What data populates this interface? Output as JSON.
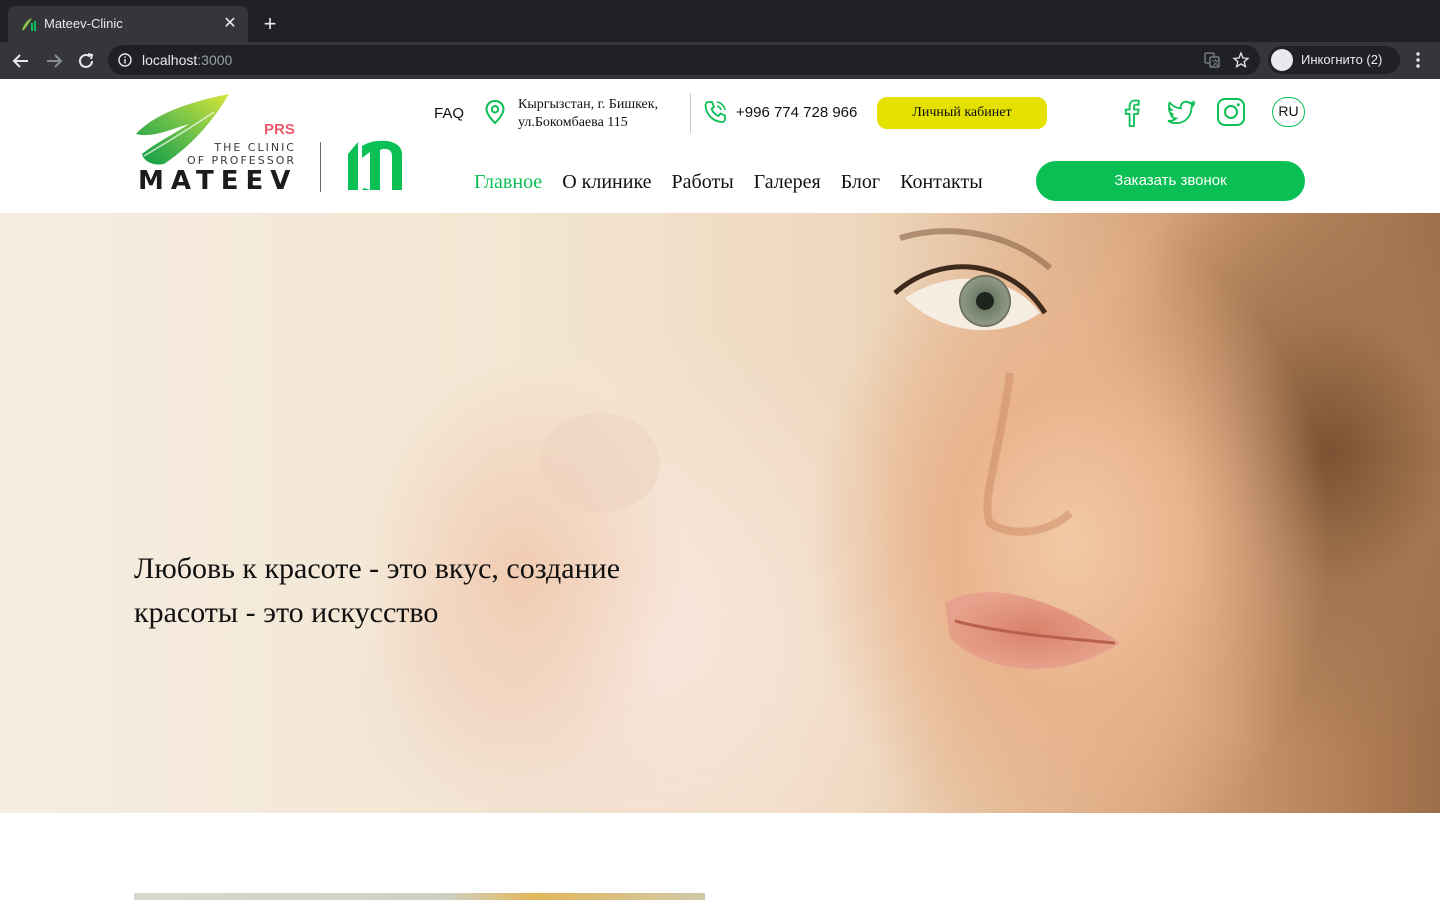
{
  "browser": {
    "tab_title": "Mateev-Clinic",
    "url_host": "localhost",
    "url_port": ":3000",
    "incognito_label": "Инкогнито (2)"
  },
  "header": {
    "logo": {
      "prs": "PRS",
      "line1": "THE CLINIC",
      "line2": "OF PROFESSOR",
      "name": "MATEEV"
    },
    "faq": "FAQ",
    "address_line1": "Кыргызстан, г. Бишкек,",
    "address_line2": "ул.Бокомбаева 115",
    "phone": "+996 774 728 966",
    "cabinet_button": "Личный кабинет",
    "language": "RU",
    "nav": [
      {
        "label": "Главное",
        "active": true
      },
      {
        "label": "О клинике",
        "active": false
      },
      {
        "label": "Работы",
        "active": false
      },
      {
        "label": "Галерея",
        "active": false
      },
      {
        "label": "Блог",
        "active": false
      },
      {
        "label": "Контакты",
        "active": false
      }
    ],
    "callback_button": "Заказать звонок",
    "social_icons": [
      "facebook-icon",
      "twitter-icon",
      "instagram-icon"
    ]
  },
  "hero": {
    "title_line1": "Любовь к красоте - это вкус, создание",
    "title_line2": "красоты - это искусство"
  },
  "colors": {
    "brand_green": "#0abf53",
    "cabinet_yellow": "#e4e000",
    "prs_red": "#ef5a6a"
  }
}
